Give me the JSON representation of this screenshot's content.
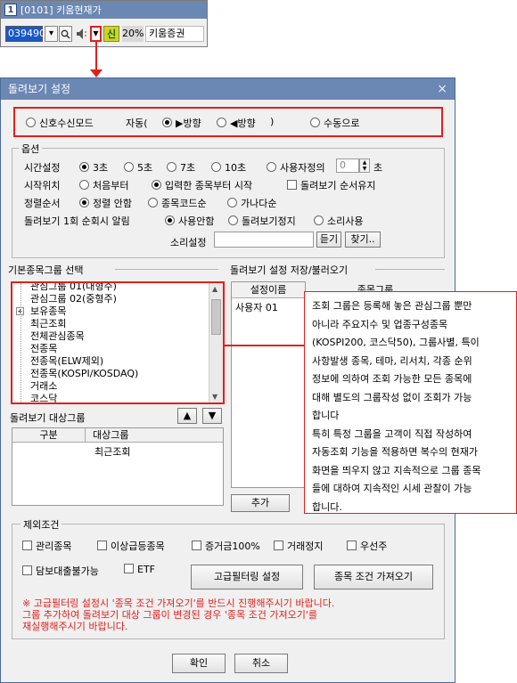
{
  "mini_window": {
    "number": "1",
    "title": "[0101] 키움현재가",
    "code": "039490",
    "shin": "신",
    "percent": "20%",
    "broker": "키움증권"
  },
  "dialog": {
    "title": "돌려보기 설정",
    "close": "×",
    "mode": {
      "signal": "신호수신모드",
      "auto_prefix": "자동(",
      "forward": "▶방향",
      "backward": "◀방향",
      "auto_suffix": ")",
      "manual": "수동으로"
    },
    "options": {
      "legend": "옵션",
      "time_label": "시간설정",
      "times": [
        "3초",
        "5초",
        "7초",
        "10초"
      ],
      "custom_label": "사용자정의",
      "custom_value": "0",
      "custom_unit": "초",
      "start_label": "시작위치",
      "start_first": "처음부터",
      "start_input": "입력한 종목부터 시작",
      "keep_order": "돌려보기 순서유지",
      "sort_label": "정렬순서",
      "sort_none": "정렬 안함",
      "sort_code": "종목코드순",
      "sort_alpha": "가나다순",
      "alert_label": "돌려보기 1회 순회시 알림",
      "alert_none": "사용안함",
      "alert_stop": "돌려보기정지",
      "alert_sound": "소리사용",
      "sound_label": "소리설정",
      "listen": "듣기",
      "find": "찾기.."
    },
    "basic_group": {
      "label": "기본종목그룹 선택",
      "items": [
        "관심그룹 01(대형주)",
        "관심그룹 02(중형주)",
        "보유종목",
        "최근조회",
        "전체관심종목",
        "전종목",
        "전종목(ELW제외)",
        "전종목(KOSPI/KOSDAQ)",
        "거래소",
        "코스닥"
      ]
    },
    "save_load": {
      "label": "돌려보기 설정 저장/불러오기",
      "col_name": "설정이름",
      "col_group": "종목그룹",
      "row_name": "사용자 01"
    },
    "target": {
      "label": "돌려보기 대상그룹",
      "up": "▲",
      "down": "▼",
      "col_type": "구분",
      "col_group": "대상그룹",
      "row_group": "최근조회",
      "add": "추가"
    },
    "exclude": {
      "legend": "제외조건",
      "items_row1": [
        "관리종목",
        "이상급등종목",
        "증거금100%",
        "거래정지",
        "우선주"
      ],
      "items_row2": [
        "담보대출불가능",
        "ETF"
      ],
      "advanced": "고급필터링 설정",
      "import": "종목 조건 가져오기"
    },
    "notice": [
      "※ 고급필터링 설정시 '종목 조건 가져오기'를 반드시 진행해주시기 바랍니다.",
      "그룹 추가하여 돌려보기 대상 그룹이 변경된 경우 '종목 조건 가져오기'를",
      "재실행해주시기 바랍니다."
    ],
    "ok": "확인",
    "cancel": "취소"
  },
  "callout": {
    "lines": [
      "조회 그룹은 등록해 놓은 관심그룹 뿐만",
      "아니라 주요지수 및 업종구성종목",
      "(KOSPI200, 코스닥50), 그룹사별, 특이",
      "사항발생 종목, 테마, 리서치, 각종 순위",
      "정보에 의하여 조회 가능한 모든 종목에",
      "대해 별도의 그룹작성 없이 조회가 가능",
      "합니다",
      "특히 특정 그룹을 고객이 직접 작성하여",
      "자동조회 기능을 적용하면 복수의 현재가",
      "화면을 띄우지 않고 지속적으로 그룹 종목",
      "들에 대하여 지속적인 시세 관찰이 가능",
      "합니다."
    ]
  }
}
